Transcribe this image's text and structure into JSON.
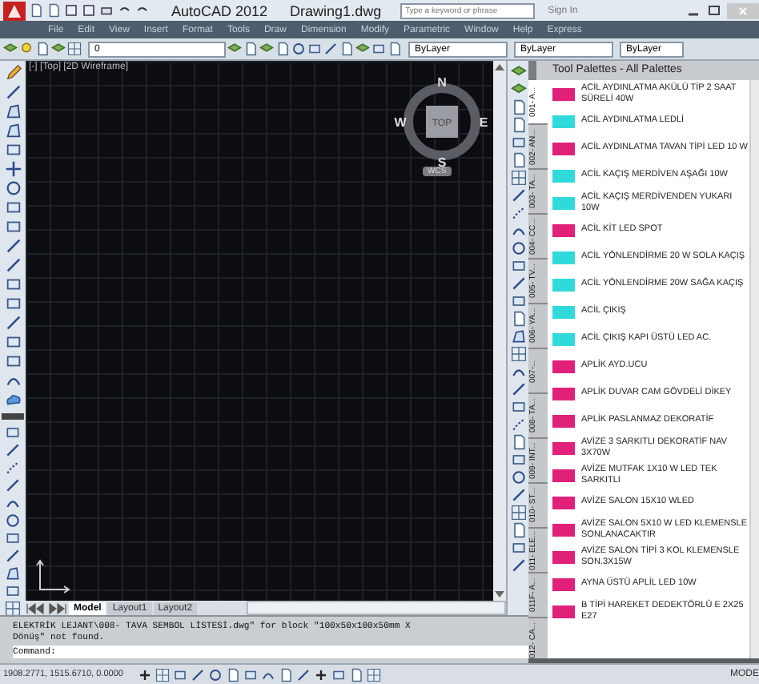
{
  "title_bar": {
    "app": "AutoCAD 2012",
    "document": "Drawing1.dwg",
    "search": {
      "placeholder": "Type a keyword or phrase"
    },
    "sign_in": "Sign In"
  },
  "menu": [
    "File",
    "Edit",
    "View",
    "Insert",
    "Format",
    "Tools",
    "Draw",
    "Dimension",
    "Modify",
    "Parametric",
    "Window",
    "Help",
    "Express"
  ],
  "toolbar": {
    "layer": "0",
    "color_control": "ByLayer",
    "linetype": "ByLayer",
    "lineweight": "ByLayer"
  },
  "viewport": {
    "label": "[-] [Top] [2D Wireframe]",
    "viewcube": {
      "face": "TOP",
      "north": "N",
      "east": "E",
      "south": "S",
      "west": "W",
      "ucs": "WCS"
    }
  },
  "layout_tabs": [
    {
      "label": "Model",
      "selected": true
    },
    {
      "label": "Layout1",
      "selected": false
    },
    {
      "label": "Layout2",
      "selected": false
    }
  ],
  "command": {
    "history": [
      "ELEKTRİK LEJANT\\008- TAVA SEMBOL LİSTESİ.dwg\" for block \"100x50x100x50mm X",
      "Dönüş\" not found."
    ],
    "prompt": "Command:"
  },
  "status_bar": {
    "coordinates": "1908.2771, 1515.6710, 0.0000",
    "space": "MODE"
  },
  "palette": {
    "title": "Tool Palettes - All Palettes",
    "tabs": [
      {
        "label": "001- A...",
        "selected": true
      },
      {
        "label": "002- AN...",
        "selected": false
      },
      {
        "label": "003- TA...",
        "selected": false
      },
      {
        "label": "004- CC...",
        "selected": false
      },
      {
        "label": "005- TV...",
        "selected": false
      },
      {
        "label": "006- YA...",
        "selected": false
      },
      {
        "label": "007-...",
        "selected": false
      },
      {
        "label": "008- TA...",
        "selected": false
      },
      {
        "label": "009- INT...",
        "selected": false
      },
      {
        "label": "010- ST...",
        "selected": false
      },
      {
        "label": "011- ELE...",
        "selected": false
      },
      {
        "label": "011F- A...",
        "selected": false
      },
      {
        "label": "012- CA...",
        "selected": false
      }
    ],
    "items": [
      {
        "label": "ACİL AYDINLATMA AKÜLÜ TİP 2 SAAT SÜRELİ 40W",
        "color": "#e0207a"
      },
      {
        "label": "ACİL AYDINLATMA LEDLİ",
        "color": "#30dada"
      },
      {
        "label": "ACİL AYDINLATMA TAVAN TİPİ LED 10 W",
        "color": "#e0207a"
      },
      {
        "label": "ACİL KAÇIŞ MERDİVEN AŞAĞI 10W",
        "color": "#30dada"
      },
      {
        "label": "ACİL KAÇIŞ MERDİVENDEN YUKARI 10W",
        "color": "#30dada"
      },
      {
        "label": "ACİL KİT LED SPOT",
        "color": "#e0207a"
      },
      {
        "label": "ACİL YÖNLENDİRME 20 W SOLA KAÇIŞ",
        "color": "#30dada"
      },
      {
        "label": "ACİL YÖNLENDİRME 20W SAĞA KAÇIŞ",
        "color": "#30dada"
      },
      {
        "label": "ACİL ÇIKIŞ",
        "color": "#30dada"
      },
      {
        "label": "ACİL ÇIKIŞ KAPI ÜSTÜ LED AC.",
        "color": "#30dada"
      },
      {
        "label": "APLİK AYD.UCU",
        "color": "#e0207a"
      },
      {
        "label": "APLİK DUVAR CAM GÖVDELİ DİKEY",
        "color": "#e0207a"
      },
      {
        "label": "APLİK PASLANMAZ DEKORATİF",
        "color": "#e0207a"
      },
      {
        "label": "AVİZE 3 SARKITLI DEKORATİF NAV 3X70W",
        "color": "#e0207a"
      },
      {
        "label": "AVİZE MUTFAK 1X10 W LED TEK SARKITLI",
        "color": "#e0207a"
      },
      {
        "label": "AVİZE SALON 15X10 WLED",
        "color": "#e0207a"
      },
      {
        "label": "AVİZE SALON 5X10 W LED KLEMENSLE SONLANACAKTIR",
        "color": "#e0207a"
      },
      {
        "label": "AVİZE SALON TİPİ 3 KOL KLEMENSLE SON.3X15W",
        "color": "#e0207a"
      },
      {
        "label": "AYNA ÜSTÜ APLİL LED 10W",
        "color": "#e0207a"
      },
      {
        "label": "B TİPİ HAREKET DEDEKTÖRLÜ E 2X25 E27",
        "color": "#e0207a"
      }
    ]
  }
}
